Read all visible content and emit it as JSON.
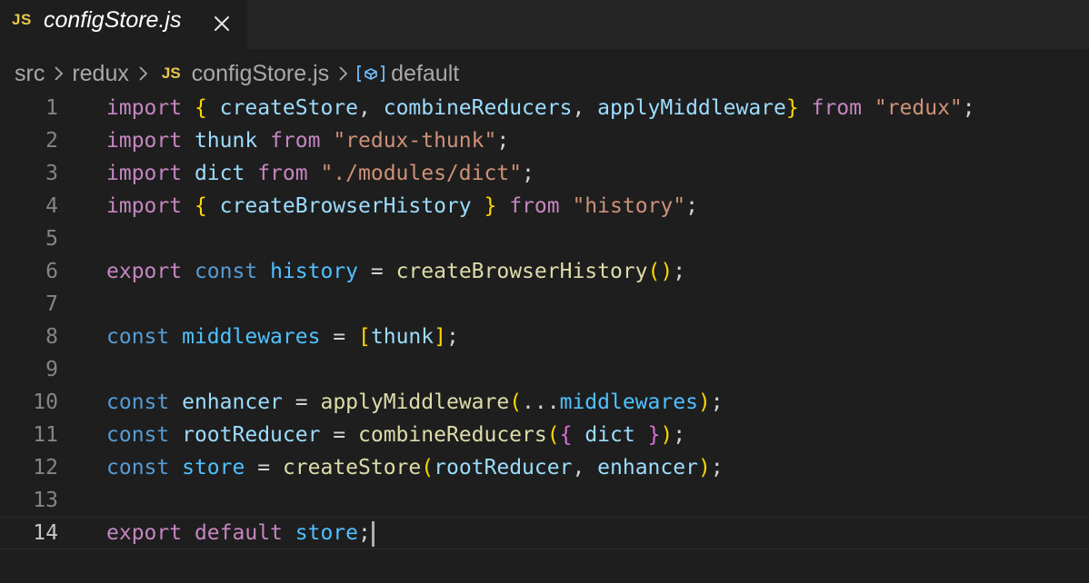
{
  "tab": {
    "language_badge": "JS",
    "title": "configStore.js",
    "close_icon": "close-icon"
  },
  "breadcrumb": {
    "items": [
      "src",
      "redux",
      "configStore.js"
    ],
    "file_badge": "JS",
    "symbol": "default",
    "symbol_icon": "symbol-variable-icon",
    "separator_icon": "chevron-right-icon"
  },
  "editor": {
    "current_line": 14,
    "colors": {
      "keyword": "#c586c0",
      "string": "#ce9178",
      "variable": "#9cdcfe",
      "constant": "#4fc1ff",
      "declaration": "#569cd6",
      "function": "#dcdcaa"
    },
    "lines": [
      {
        "num": "1",
        "text": "import { createStore, combineReducers, applyMiddleware} from \"redux\";"
      },
      {
        "num": "2",
        "text": "import thunk from \"redux-thunk\";"
      },
      {
        "num": "3",
        "text": "import dict from \"./modules/dict\";"
      },
      {
        "num": "4",
        "text": "import { createBrowserHistory } from \"history\";"
      },
      {
        "num": "5",
        "text": ""
      },
      {
        "num": "6",
        "text": "export const history = createBrowserHistory();"
      },
      {
        "num": "7",
        "text": ""
      },
      {
        "num": "8",
        "text": "const middlewares = [thunk];"
      },
      {
        "num": "9",
        "text": ""
      },
      {
        "num": "10",
        "text": "const enhancer = applyMiddleware(...middlewares);"
      },
      {
        "num": "11",
        "text": "const rootReducer = combineReducers({ dict });"
      },
      {
        "num": "12",
        "text": "const store = createStore(rootReducer, enhancer);"
      },
      {
        "num": "13",
        "text": ""
      },
      {
        "num": "14",
        "text": "export default store;"
      }
    ]
  }
}
